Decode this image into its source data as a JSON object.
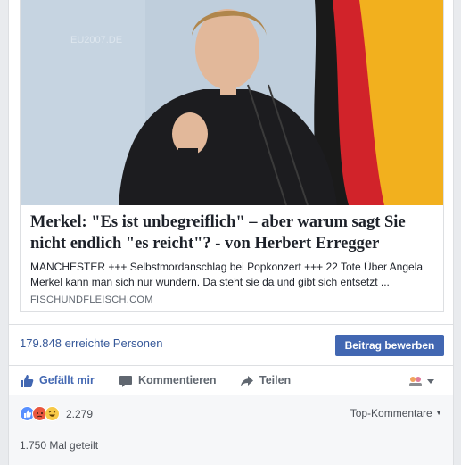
{
  "post": {
    "headline": "Merkel: \"Es ist unbegreiflich\" – aber warum sagt Sie nicht endlich \"es reicht\"? - von Herbert Erregger",
    "description": "MANCHESTER +++ Selbstmordanschlag bei Popkonzert +++ 22 Tote Über Angela Merkel kann man sich nur wundern. Da steht sie da und gibt sich entsetzt ...",
    "domain": "FISCHUNDFLEISCH.COM",
    "photo_alt": "Photo of a speaker at a podium with a German flag",
    "photo_text": "EU2007.DE"
  },
  "insights": {
    "reach_label": "179.848 erreichte Personen",
    "boost_button": "Beitrag bewerben"
  },
  "actions": {
    "like": "Gefällt mir",
    "comment": "Kommentieren",
    "share": "Teilen"
  },
  "reactions": {
    "count": "2.279",
    "top_comments": "Top-Kommentare",
    "types": [
      "like-icon",
      "angry-icon",
      "haha-icon"
    ]
  },
  "shares": {
    "label": "1.750 Mal geteilt"
  },
  "colors": {
    "link": "#365899",
    "button": "#4267b2",
    "flag_black": "#1a1a1a",
    "flag_red": "#d1232a",
    "flag_gold": "#f2b01e"
  }
}
